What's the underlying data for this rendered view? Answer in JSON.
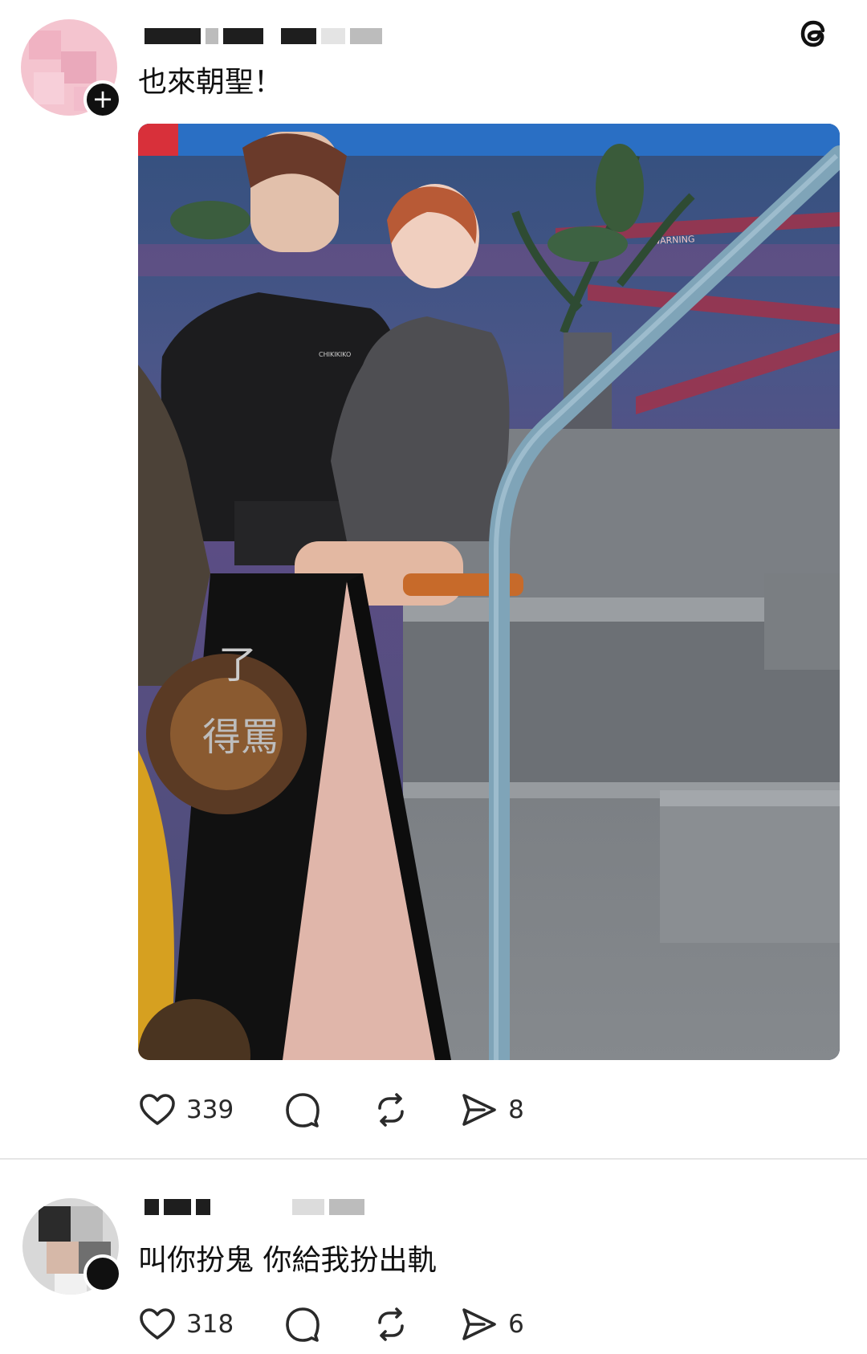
{
  "posts": [
    {
      "text": "也來朝聖！",
      "likes": "339",
      "reposts_shown": "",
      "shares": "8",
      "image": {
        "cutout_logo_text": "CHIKIKIKO",
        "sign_text_1": "了",
        "sign_text_2": "得罵",
        "tape_text": "WARNING"
      }
    },
    {
      "text": "叫你扮鬼 你給我扮出軌",
      "likes": "318",
      "shares": "6"
    }
  ],
  "icons": {
    "app_logo": "threads-logo-icon",
    "like": "heart-icon",
    "comment": "comment-bubble-icon",
    "repost": "repost-arrows-icon",
    "share": "send-paper-plane-icon",
    "follow": "plus-icon"
  },
  "colors": {
    "text": "#101010",
    "count": "#2a2a2a",
    "divider": "#e6e6e6",
    "avatar_pink": "#f4c4cf",
    "railing": "#7fa4b8"
  }
}
